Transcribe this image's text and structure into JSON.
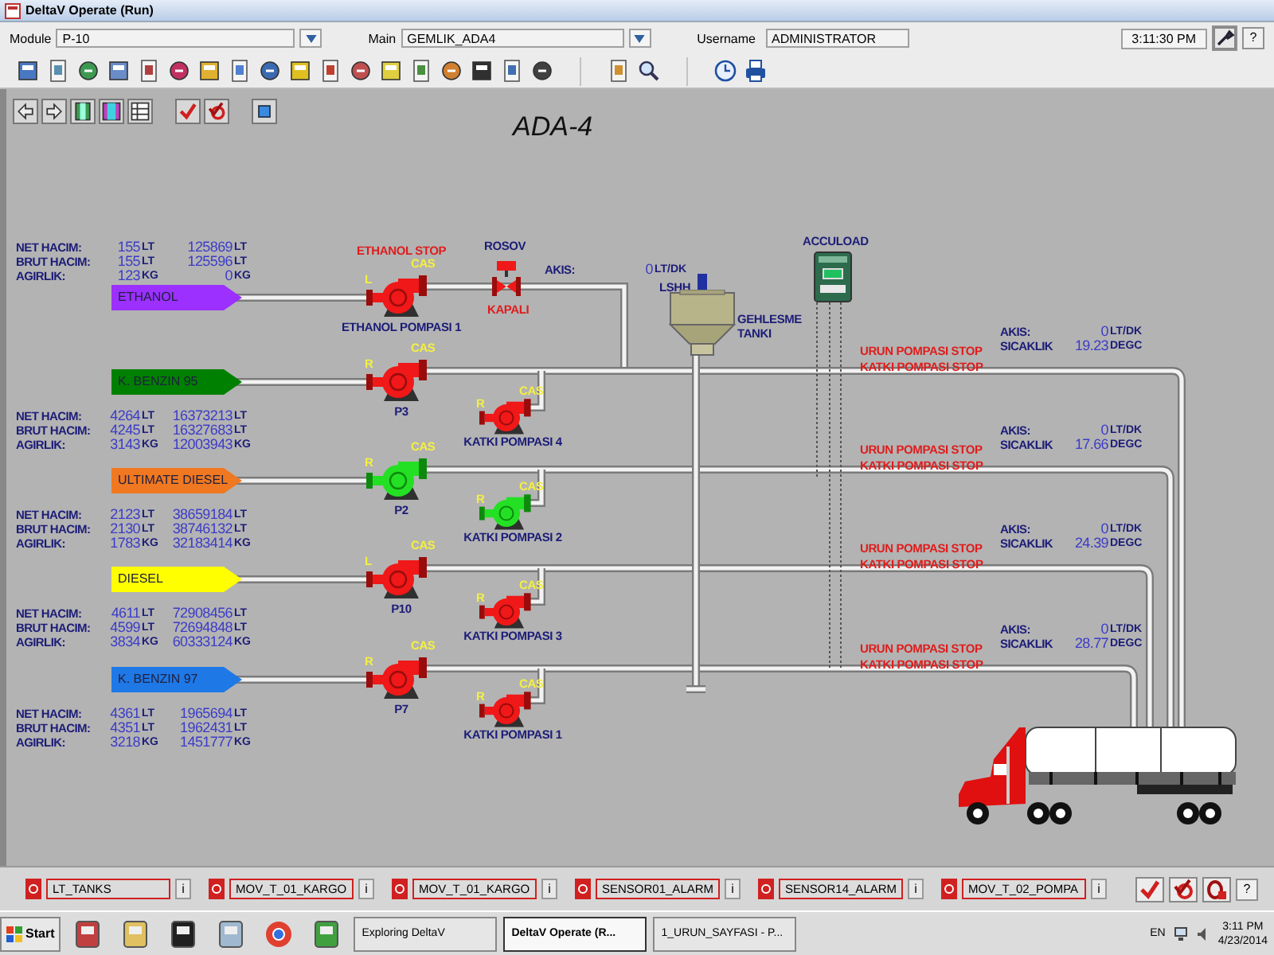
{
  "window": {
    "title": "DeltaV Operate (Run)"
  },
  "header": {
    "fields": [
      {
        "label": "Module",
        "value": "P-10",
        "dropdown": true
      },
      {
        "label": "Main",
        "value": "GEMLIK_ADA4",
        "dropdown": true
      },
      {
        "label": "Username",
        "value": "ADMINISTRATOR",
        "dropdown": false
      }
    ],
    "time": "3:11:30 PM",
    "help": "?"
  },
  "display": {
    "title": "ADA-4"
  },
  "products": [
    {
      "name": "ETHANOL",
      "color": "#9b30ff",
      "readings": [
        {
          "label": "NET HACIM:",
          "value_1": "155",
          "unit_1": "LT",
          "value_2": "125869",
          "unit_2": "LT"
        },
        {
          "label": "BRUT HACIM:",
          "value_1": "155",
          "unit_1": "LT",
          "value_2": "125596",
          "unit_2": "LT"
        },
        {
          "label": "AGIRLIK:",
          "value_1": "123",
          "unit_1": "KG",
          "value_2": "0",
          "unit_2": "KG"
        }
      ],
      "pump": {
        "label": "ETHANOL POMPASI 1",
        "mode": "L",
        "control": "CAS",
        "running": false
      },
      "stop_text": "ETHANOL STOP",
      "valve": {
        "label": "ROSOV",
        "state": "KAPALI",
        "open": false
      },
      "flow": {
        "label": "AKIS:",
        "value": "0",
        "unit": "LT/DK"
      }
    },
    {
      "name": "K. BENZIN 95",
      "color": "#008000",
      "readings": [
        {
          "label": "NET HACIM:",
          "value_1": "4264",
          "unit_1": "LT",
          "value_2": "16373213",
          "unit_2": "LT"
        },
        {
          "label": "BRUT HACIM:",
          "value_1": "4245",
          "unit_1": "LT",
          "value_2": "16327683",
          "unit_2": "LT"
        },
        {
          "label": "AGIRLIK:",
          "value_1": "3143",
          "unit_1": "KG",
          "value_2": "12003943",
          "unit_2": "KG"
        }
      ],
      "pump": {
        "label": "P3",
        "mode": "R",
        "control": "CAS",
        "running": false
      },
      "additive_pump": {
        "label": "KATKI POMPASI 4",
        "mode": "R",
        "control": "CAS",
        "running": false
      },
      "alarms": [
        "URUN POMPASI STOP",
        "KATKI POMPASI STOP"
      ],
      "flow": {
        "label": "AKIS:",
        "value": "0",
        "unit": "LT/DK"
      },
      "temperature": {
        "label": "SICAKLIK",
        "value": "19.23",
        "unit": "DEGC"
      }
    },
    {
      "name": "ULTIMATE DIESEL",
      "color": "#f07820",
      "readings": [
        {
          "label": "NET HACIM:",
          "value_1": "2123",
          "unit_1": "LT",
          "value_2": "38659184",
          "unit_2": "LT"
        },
        {
          "label": "BRUT HACIM:",
          "value_1": "2130",
          "unit_1": "LT",
          "value_2": "38746132",
          "unit_2": "LT"
        },
        {
          "label": "AGIRLIK:",
          "value_1": "1783",
          "unit_1": "KG",
          "value_2": "32183414",
          "unit_2": "KG"
        }
      ],
      "pump": {
        "label": "P2",
        "mode": "R",
        "control": "CAS",
        "running": true
      },
      "additive_pump": {
        "label": "KATKI POMPASI 2",
        "mode": "R",
        "control": "CAS",
        "running": true
      },
      "alarms": [
        "URUN POMPASI STOP",
        "KATKI POMPASI STOP"
      ],
      "flow": {
        "label": "AKIS:",
        "value": "0",
        "unit": "LT/DK"
      },
      "temperature": {
        "label": "SICAKLIK",
        "value": "17.66",
        "unit": "DEGC"
      }
    },
    {
      "name": "DIESEL",
      "color": "#ffff00",
      "readings": [
        {
          "label": "NET HACIM:",
          "value_1": "4611",
          "unit_1": "LT",
          "value_2": "72908456",
          "unit_2": "LT"
        },
        {
          "label": "BRUT HACIM:",
          "value_1": "4599",
          "unit_1": "LT",
          "value_2": "72694848",
          "unit_2": "LT"
        },
        {
          "label": "AGIRLIK:",
          "value_1": "3834",
          "unit_1": "KG",
          "value_2": "60333124",
          "unit_2": "KG"
        }
      ],
      "pump": {
        "label": "P10",
        "mode": "L",
        "control": "CAS",
        "running": false
      },
      "additive_pump": {
        "label": "KATKI POMPASI 3",
        "mode": "R",
        "control": "CAS",
        "running": false
      },
      "alarms": [
        "URUN POMPASI STOP",
        "KATKI POMPASI STOP"
      ],
      "flow": {
        "label": "AKIS:",
        "value": "0",
        "unit": "LT/DK"
      },
      "temperature": {
        "label": "SICAKLIK",
        "value": "24.39",
        "unit": "DEGC"
      }
    },
    {
      "name": "K. BENZIN 97",
      "color": "#1e78e6",
      "readings": [
        {
          "label": "NET HACIM:",
          "value_1": "4361",
          "unit_1": "LT",
          "value_2": "1965694",
          "unit_2": "LT"
        },
        {
          "label": "BRUT HACIM:",
          "value_1": "4351",
          "unit_1": "LT",
          "value_2": "1962431",
          "unit_2": "LT"
        },
        {
          "label": "AGIRLIK:",
          "value_1": "3218",
          "unit_1": "KG",
          "value_2": "1451777",
          "unit_2": "KG"
        }
      ],
      "pump": {
        "label": "P7",
        "mode": "R",
        "control": "CAS",
        "running": false
      },
      "additive_pump": {
        "label": "KATKI POMPASI 1",
        "mode": "R",
        "control": "CAS",
        "running": false
      },
      "alarms": [
        "URUN POMPASI STOP",
        "KATKI POMPASI STOP"
      ],
      "flow": {
        "label": "AKIS:",
        "value": "0",
        "unit": "LT/DK"
      },
      "temperature": {
        "label": "SICAKLIK",
        "value": "28.77",
        "unit": "DEGC"
      }
    }
  ],
  "tank": {
    "label": "GEHLESME TANKI",
    "switch_label": "LSHH"
  },
  "meter": {
    "label": "ACCULOAD"
  },
  "alarm_bar": {
    "alarms": [
      {
        "tag": "LT_TANKS",
        "info": "i"
      },
      {
        "tag": "MOV_T_01_KARGO",
        "info": "i"
      },
      {
        "tag": "MOV_T_01_KARGO",
        "info": "i"
      },
      {
        "tag": "SENSOR01_ALARM",
        "info": "i"
      },
      {
        "tag": "SENSOR14_ALARM",
        "info": "i"
      },
      {
        "tag": "MOV_T_02_POMPA",
        "info": "i"
      }
    ],
    "help": "?"
  },
  "taskbar": {
    "start": "Start",
    "tasks": [
      {
        "label": "Exploring DeltaV",
        "selected": false
      },
      {
        "label": "DeltaV Operate (R...",
        "selected": true
      },
      {
        "label": "1_URUN_SAYFASI - P...",
        "selected": false
      }
    ],
    "language": "EN",
    "time": "3:11 PM",
    "date": "4/23/2014"
  }
}
